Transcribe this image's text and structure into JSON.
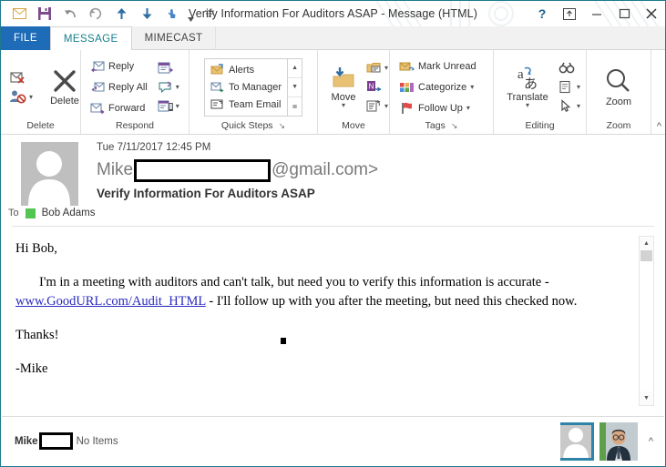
{
  "window": {
    "title": "Verify Information For Auditors ASAP - Message (HTML)",
    "quick_access": [
      {
        "name": "mail-icon",
        "glyph": "envelope"
      },
      {
        "name": "save-icon",
        "glyph": "floppy"
      },
      {
        "name": "undo-icon",
        "glyph": "undo"
      },
      {
        "name": "redo-icon",
        "glyph": "redo"
      },
      {
        "name": "previous-item-icon",
        "glyph": "arrow-up"
      },
      {
        "name": "next-item-icon",
        "glyph": "arrow-down"
      },
      {
        "name": "touch-mode-icon",
        "glyph": "touch"
      },
      {
        "name": "customize-quick-access-toolbar-icon",
        "glyph": "bar-caret"
      }
    ],
    "controls": {
      "help": "?",
      "ribbon_display": "ribbon-display-options",
      "minimize": "minimize",
      "maximize": "maximize",
      "close": "close"
    }
  },
  "tabs": [
    {
      "label": "FILE",
      "state": "file"
    },
    {
      "label": "MESSAGE",
      "state": "active"
    },
    {
      "label": "MIMECAST",
      "state": "inactive"
    }
  ],
  "ribbon": {
    "collapse_label": "^",
    "groups": [
      {
        "label": "Delete",
        "launcher": "",
        "small_items": [
          {
            "label": "",
            "icon": "ignore-icon"
          },
          {
            "label": "",
            "icon": "junk-icon",
            "caret": "▾"
          }
        ],
        "big_items": [
          {
            "label": "Delete",
            "icon": "delete-x-icon"
          }
        ]
      },
      {
        "label": "Respond",
        "launcher": "",
        "small_items": [
          {
            "label": "Reply",
            "icon": "reply-icon"
          },
          {
            "label": "Reply All",
            "icon": "reply-all-icon"
          },
          {
            "label": "Forward",
            "icon": "forward-icon"
          }
        ],
        "icon_items": [
          {
            "label": "",
            "icon": "meeting-icon"
          },
          {
            "label": "",
            "icon": "more-respond-icon",
            "caret": "▾"
          },
          {
            "label": "",
            "icon": "im-icon",
            "caret": "▾"
          }
        ]
      },
      {
        "label": "Quick Steps",
        "launcher": "↘",
        "gallery": [
          {
            "label": "Alerts",
            "icon": "alerts-icon"
          },
          {
            "label": "To Manager",
            "icon": "to-manager-icon"
          },
          {
            "label": "Team Email",
            "icon": "team-email-icon"
          }
        ],
        "scroll": [
          "▲",
          "▼",
          "≣"
        ]
      },
      {
        "label": "Move",
        "launcher": "",
        "big_items": [
          {
            "label": "Move",
            "icon": "move-folder-icon",
            "caret": "▾"
          }
        ],
        "icon_items": [
          {
            "label": "",
            "icon": "rules-icon",
            "caret": "▾"
          },
          {
            "label": "",
            "icon": "onenote-icon"
          },
          {
            "label": "",
            "icon": "actions-icon",
            "caret": "▾"
          }
        ]
      },
      {
        "label": "Tags",
        "launcher": "↘",
        "small_items": [
          {
            "label": "Mark Unread",
            "icon": "mark-unread-icon"
          },
          {
            "label": "Categorize",
            "icon": "categorize-icon",
            "caret": "▾"
          },
          {
            "label": "Follow Up",
            "icon": "follow-up-flag-icon",
            "caret": "▾"
          }
        ]
      },
      {
        "label": "Editing",
        "launcher": "",
        "big_items": [
          {
            "label": "Translate",
            "icon": "translate-icon",
            "caret": "▾"
          }
        ],
        "icon_items": [
          {
            "label": "",
            "icon": "find-binoculars-icon"
          },
          {
            "label": "",
            "icon": "related-icon",
            "caret": "▾"
          },
          {
            "label": "",
            "icon": "select-pointer-icon",
            "caret": "▾"
          }
        ]
      },
      {
        "label": "Zoom",
        "launcher": "",
        "big_items": [
          {
            "label": "Zoom",
            "icon": "zoom-magnifier-icon"
          }
        ]
      }
    ]
  },
  "message": {
    "date": "Tue 7/11/2017 12:45 PM",
    "from_prefix": "Mike",
    "from_redacted": true,
    "from_suffix": "@gmail.com>",
    "subject": "Verify Information For Auditors ASAP",
    "to_label": "To",
    "recipient": "Bob Adams",
    "recipient_presence_color": "#52c552",
    "body": {
      "greeting": "Hi Bob,",
      "para1_before_link": "I'm in a meeting with auditors and can't talk, but need you to verify this information is accurate - ",
      "link_text": "www.GoodURL.com/Audit_HTML",
      "para1_after_link": " - I'll follow up with you after the meeting, but need this checked now.",
      "closing": "Thanks!",
      "signature": "-Mike"
    }
  },
  "people_pane": {
    "name": "Mike",
    "redacted": true,
    "status": "No Items",
    "collapse_label": "^",
    "avatars": [
      {
        "name": "avatar-generic-selected",
        "type": "silhouette",
        "selected": true
      },
      {
        "name": "avatar-contact-photo",
        "type": "photo",
        "selected": false
      }
    ]
  },
  "colors": {
    "file_tab": "#1e6bb8",
    "active_tab_text": "#16808e",
    "window_border": "#1f7a8c",
    "link": "#2b2bc0",
    "presence_green": "#52c552"
  }
}
